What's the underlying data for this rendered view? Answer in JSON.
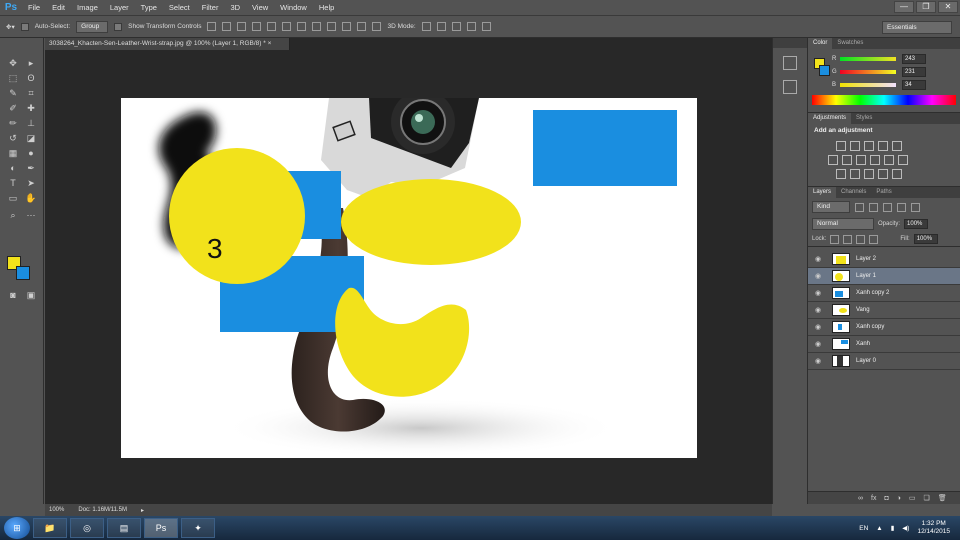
{
  "app": {
    "logo": "Ps"
  },
  "menu": [
    "File",
    "Edit",
    "Image",
    "Layer",
    "Type",
    "Select",
    "Filter",
    "3D",
    "View",
    "Window",
    "Help"
  ],
  "window_controls": {
    "minimize": "—",
    "restore": "❐",
    "close": "✕"
  },
  "options_bar": {
    "auto_select_label": "Auto-Select:",
    "auto_select_value": "Group",
    "show_transform_label": "Show Transform Controls",
    "mode_3d_label": "3D Mode:",
    "workspace": "Essentials"
  },
  "document": {
    "tab_title": "3038264_Khacten-Sen-Leather-Wrist-strap.jpg @ 100% (Layer 1, RGB/8) *",
    "close_glyph": "×",
    "canvas_text": "3"
  },
  "status": {
    "zoom": "100%",
    "doc": "Doc: 1.16M/11.5M"
  },
  "color_panel": {
    "tabs": [
      "Color",
      "Swatches"
    ],
    "sliders": [
      {
        "label": "R",
        "value": "243"
      },
      {
        "label": "G",
        "value": "231"
      },
      {
        "label": "B",
        "value": "34"
      }
    ],
    "fg_color": "#f2e21b",
    "bg_color": "#1a8ee0"
  },
  "adjustments_panel": {
    "tabs": [
      "Adjustments",
      "Styles"
    ],
    "heading": "Add an adjustment"
  },
  "layers_panel": {
    "tabs": [
      "Layers",
      "Channels",
      "Paths"
    ],
    "filter_kind": "Kind",
    "blend_mode": "Normal",
    "opacity_label": "Opacity:",
    "opacity_value": "100%",
    "lock_label": "Lock:",
    "fill_label": "Fill:",
    "fill_value": "100%",
    "layers": [
      {
        "name": "Layer 2",
        "selected": false
      },
      {
        "name": "Layer 1",
        "selected": true
      },
      {
        "name": "Xanh copy 2",
        "selected": false
      },
      {
        "name": "Vang",
        "selected": false
      },
      {
        "name": "Xanh copy",
        "selected": false
      },
      {
        "name": "Xanh",
        "selected": false
      },
      {
        "name": "Layer 0",
        "selected": false
      }
    ],
    "footer_icons": [
      "link-icon",
      "fx-icon",
      "mask-icon",
      "adjustment-icon",
      "folder-icon",
      "new-layer-icon",
      "trash-icon"
    ]
  },
  "taskbar": {
    "language": "EN",
    "time": "1:32 PM",
    "date": "12/14/2015",
    "active_app_label": "Ps"
  }
}
